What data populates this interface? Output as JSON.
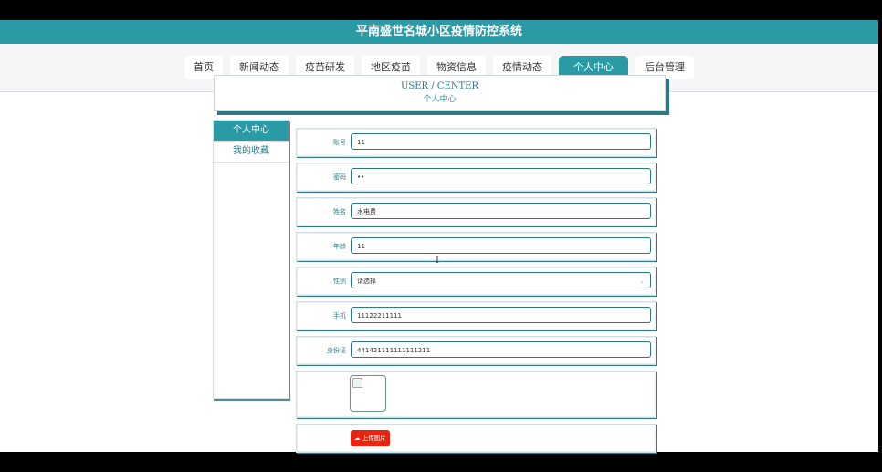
{
  "app_title": "平南盛世名城小区疫情防控系统",
  "nav": [
    {
      "label": "首页",
      "active": false
    },
    {
      "label": "新闻动态",
      "active": false
    },
    {
      "label": "疫苗研发",
      "active": false
    },
    {
      "label": "地区疫苗",
      "active": false
    },
    {
      "label": "物资信息",
      "active": false
    },
    {
      "label": "疫情动态",
      "active": false
    },
    {
      "label": "个人中心",
      "active": true
    },
    {
      "label": "后台管理",
      "active": false
    }
  ],
  "banner": {
    "en": "USER / CENTER",
    "cn": "个人中心"
  },
  "sidebar": [
    {
      "label": "个人中心",
      "active": true
    },
    {
      "label": "我的收藏",
      "active": false
    }
  ],
  "form": {
    "account": {
      "label": "账号",
      "value": "11"
    },
    "password": {
      "label": "密码",
      "value": "••"
    },
    "name": {
      "label": "姓名",
      "value": "水电费"
    },
    "age": {
      "label": "年龄",
      "value": "11"
    },
    "gender": {
      "label": "性别",
      "value": "请选择"
    },
    "phone": {
      "label": "手机",
      "value": "11122211111"
    },
    "id_card": {
      "label": "身份证",
      "value": "441421111111111211"
    },
    "upload_label": "上传图片"
  },
  "colors": {
    "accent": "#2a9aa5",
    "upload": "#e8260f"
  }
}
